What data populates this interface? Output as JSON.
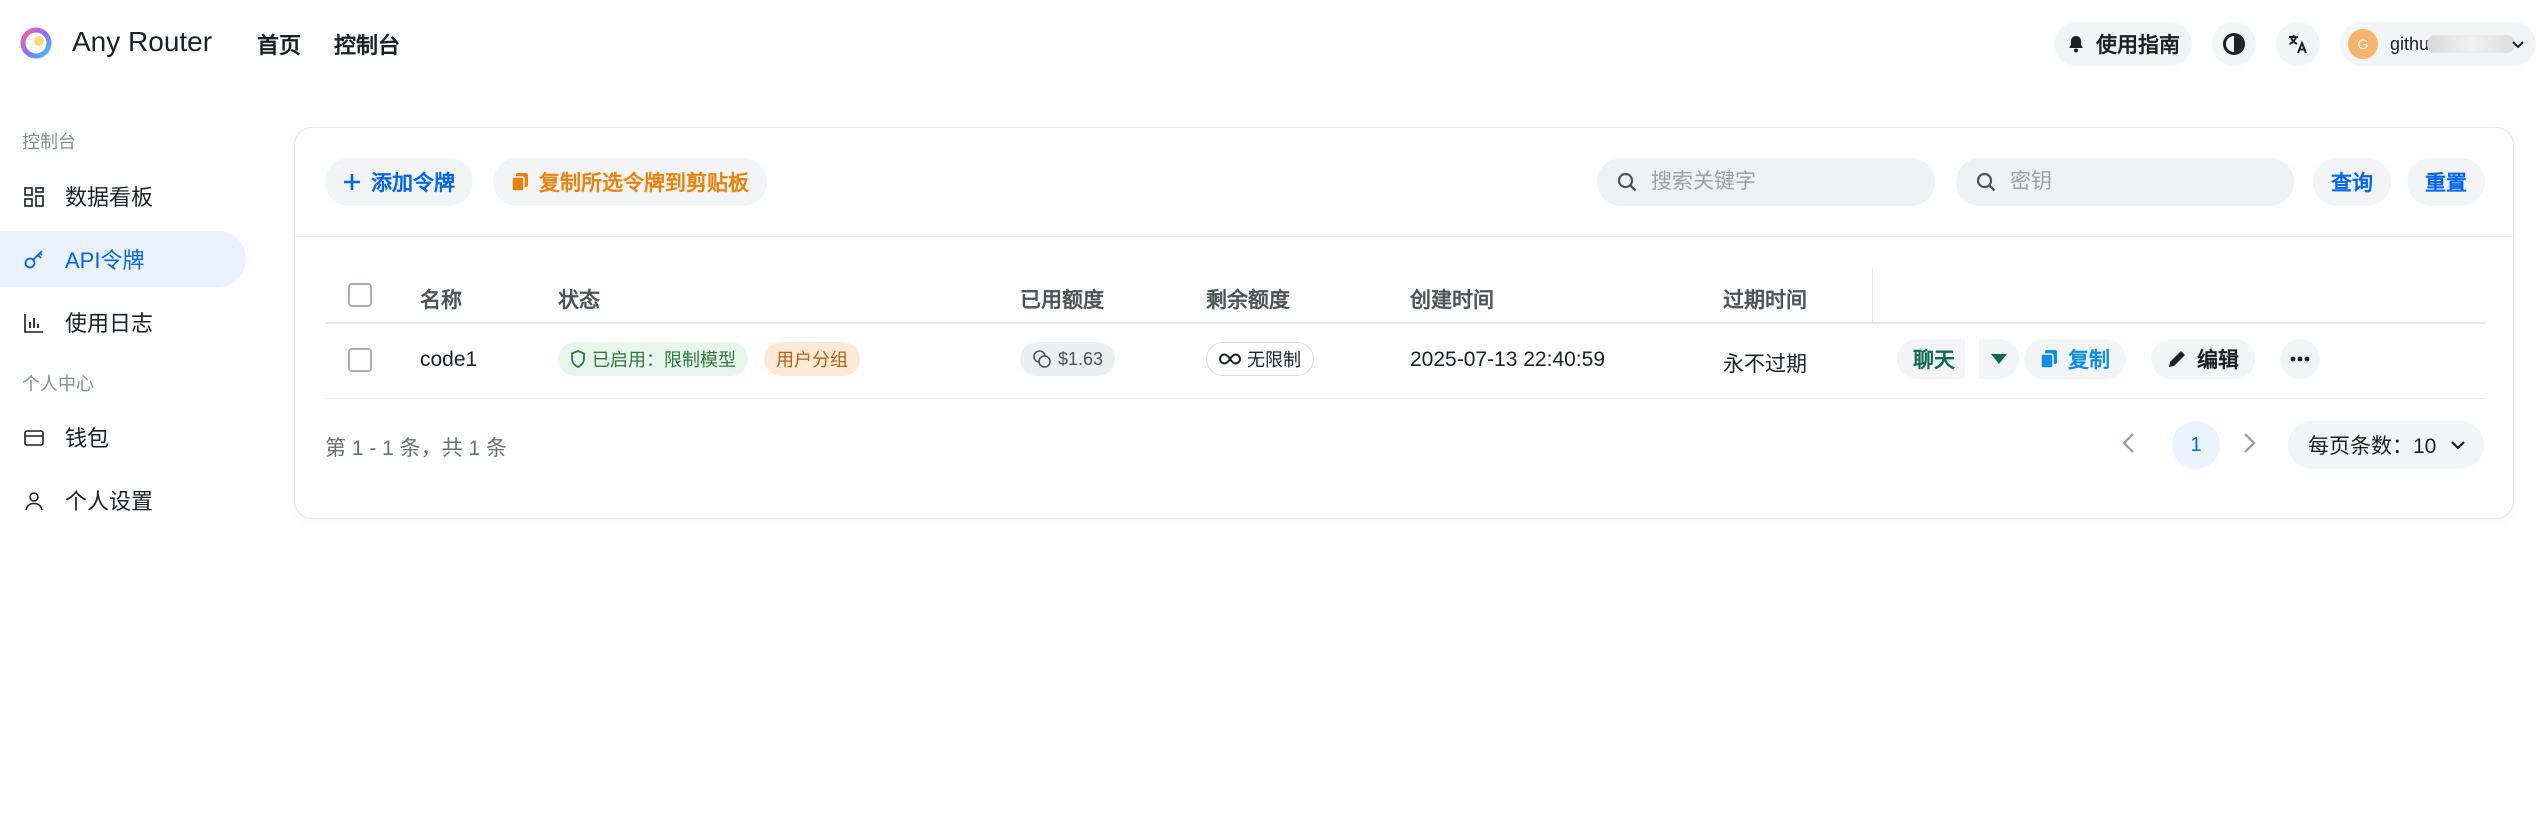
{
  "header": {
    "app_title": "Any Router",
    "nav": [
      "首页",
      "控制台"
    ],
    "guide_label": "使用指南",
    "user_initial": "G",
    "user_name": "githu"
  },
  "sidebar": {
    "sections": [
      "控制台",
      "个人中心"
    ],
    "items": [
      {
        "label": "数据看板",
        "icon": "dashboard-icon",
        "active": false
      },
      {
        "label": "API令牌",
        "icon": "key-icon",
        "active": true
      },
      {
        "label": "使用日志",
        "icon": "bar-chart-icon",
        "active": false
      },
      {
        "label": "钱包",
        "icon": "wallet-icon",
        "active": false
      },
      {
        "label": "个人设置",
        "icon": "user-icon",
        "active": false
      }
    ]
  },
  "toolbar": {
    "add_label": "添加令牌",
    "copy_selected_label": "复制所选令牌到剪贴板",
    "search_keyword_placeholder": "搜索关键字",
    "search_key_placeholder": "密钥",
    "query_label": "查询",
    "reset_label": "重置"
  },
  "table": {
    "columns": [
      "名称",
      "状态",
      "已用额度",
      "剩余额度",
      "创建时间",
      "过期时间"
    ],
    "rows": [
      {
        "name": "code1",
        "status": "已启用：限制模型",
        "group": "用户分组",
        "used": "$1.63",
        "remaining": "无限制",
        "created": "2025-07-13 22:40:59",
        "expire": "永不过期",
        "actions": {
          "chat": "聊天",
          "copy": "复制",
          "edit": "编辑"
        }
      }
    ]
  },
  "pagination": {
    "summary": "第 1 - 1 条，共 1 条",
    "current_page": "1",
    "per_page_label": "每页条数：10"
  },
  "colors": {
    "primary": "#0064fa",
    "copy_orange": "#e8830c",
    "chat_green": "#0b6b4f",
    "active_bg": "#eaf3fd"
  }
}
